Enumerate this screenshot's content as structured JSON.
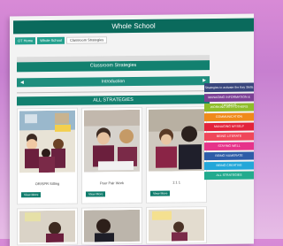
{
  "window": {
    "title": "Whole School"
  },
  "breadcrumb": [
    {
      "label": "OT Home",
      "active": false
    },
    {
      "label": "Whole School",
      "active": false
    },
    {
      "label": "Classroom Strategies",
      "active": true
    }
  ],
  "main": {
    "section_title": "Classroom Strategies",
    "intro_label": "Introduction",
    "all_label": "ALL STRATEGIES",
    "cards": [
      {
        "caption": "OR/SPR Sitting",
        "button": "View More"
      },
      {
        "caption": "Peer Pair Work",
        "button": "View More"
      },
      {
        "caption": "1:1 1",
        "button": "View More"
      }
    ]
  },
  "sidebar": {
    "header": "Strategies to activate the Key Skills",
    "items": [
      {
        "label": "MANAGING INFORMATION & THINKING",
        "color": "#7b3f95"
      },
      {
        "label": "WORKING WITH OTHERS",
        "color": "#8fbd2b"
      },
      {
        "label": "COMMUNICATION",
        "color": "#f08a1a"
      },
      {
        "label": "MANAGING MYSELF",
        "color": "#e3233b"
      },
      {
        "label": "BEING LITERATE",
        "color": "#f0475a"
      },
      {
        "label": "STAYING WELL",
        "color": "#e6338a"
      },
      {
        "label": "BEING NUMERATE",
        "color": "#2d5da8"
      },
      {
        "label": "BEING CREATIVE",
        "color": "#23a7d9"
      },
      {
        "label": "ALL STRATEGIES",
        "color": "#23ab8e"
      }
    ]
  }
}
